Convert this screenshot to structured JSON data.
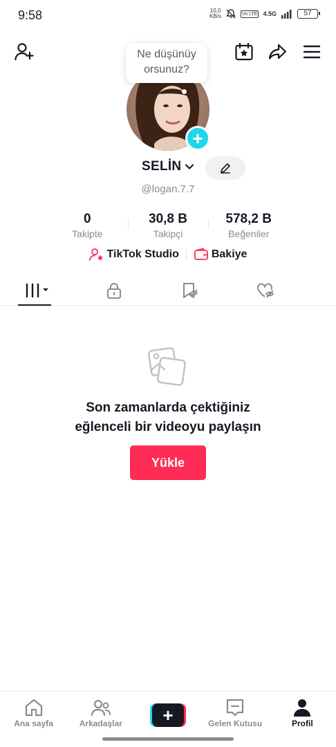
{
  "status_bar": {
    "time": "9:58",
    "speed_value": "10,0",
    "speed_unit": "KB/s",
    "volte": "Vo LTE",
    "network": "4.5G",
    "battery": "57"
  },
  "header": {
    "icons": [
      "add-friend-icon",
      "calendar-star-icon",
      "share-icon",
      "menu-icon"
    ]
  },
  "bubble": {
    "line1": "Ne düşünüy",
    "line2": "orsunuz?"
  },
  "profile": {
    "name": "SELİN",
    "username": "@logan.7.7"
  },
  "stats": [
    {
      "value": "0",
      "label": "Takipte"
    },
    {
      "value": "30,8 B",
      "label": "Takipçi"
    },
    {
      "value": "578,2 B",
      "label": "Beğeniler"
    }
  ],
  "links": {
    "studio": "TikTok Studio",
    "balance": "Bakiye"
  },
  "tabs": [
    "videos-grid-icon",
    "lock-icon",
    "bookmark-icon",
    "heart-icon"
  ],
  "empty_state": {
    "line1": "Son zamanlarda çektiğiniz",
    "line2": "eğlenceli bir videoyu paylaşın",
    "button": "Yükle"
  },
  "bottom_nav": [
    {
      "label": "Ana sayfa",
      "icon": "home-icon"
    },
    {
      "label": "Arkadaşlar",
      "icon": "friends-icon"
    },
    {
      "label": "",
      "icon": "create-icon"
    },
    {
      "label": "Gelen Kutusu",
      "icon": "inbox-icon"
    },
    {
      "label": "Profil",
      "icon": "profile-icon"
    }
  ],
  "colors": {
    "accent": "#fe2c55",
    "cyan": "#20d5ec",
    "text": "#161823",
    "muted": "#8a8b91"
  }
}
